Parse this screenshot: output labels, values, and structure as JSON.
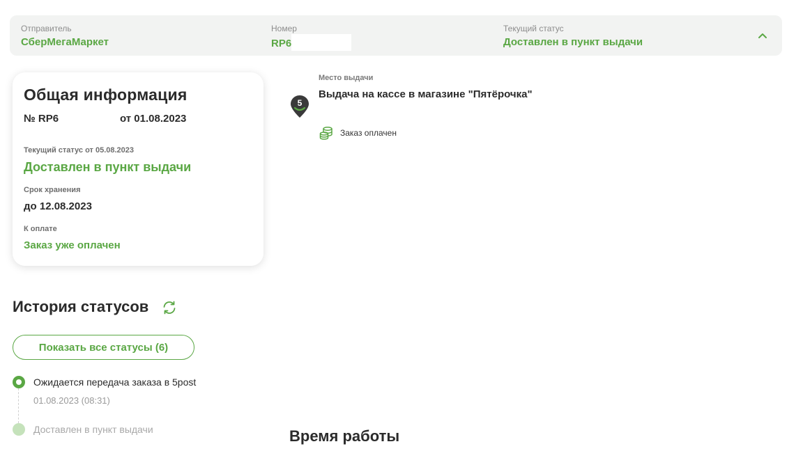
{
  "header": {
    "sender_label": "Отправитель",
    "sender_value": "СберМегаМаркет",
    "number_label": "Номер",
    "number_value": "RP6",
    "status_label": "Текущий статус",
    "status_value": "Доставлен в пункт выдачи"
  },
  "info": {
    "title": "Общая информация",
    "order_number": "№ RP6",
    "order_date": "от 01.08.2023",
    "status_label": "Текущий статус от 05.08.2023",
    "status_value": "Доставлен в пункт выдачи",
    "storage_label": "Срок хранения",
    "storage_value": "до 12.08.2023",
    "payment_label": "К оплате",
    "payment_value": "Заказ уже оплачен"
  },
  "pickup": {
    "pin_number": "5",
    "label": "Место выдачи",
    "name": "Выдача на кассе в магазине \"Пятёрочка\"",
    "paid_text": "Заказ оплачен"
  },
  "history": {
    "title": "История статусов",
    "show_all_label": "Показать все статусы (6)",
    "statuses": [
      {
        "text": "Ожидается передача заказа в 5post",
        "time": "01.08.2023 (08:31)"
      },
      {
        "text": "Доставлен в пункт выдачи"
      }
    ]
  },
  "hours": {
    "title": "Время работы"
  },
  "colors": {
    "accent_green": "#5aa744",
    "header_bg": "#f2f3f2",
    "pin_dark": "#3a3a3a"
  }
}
